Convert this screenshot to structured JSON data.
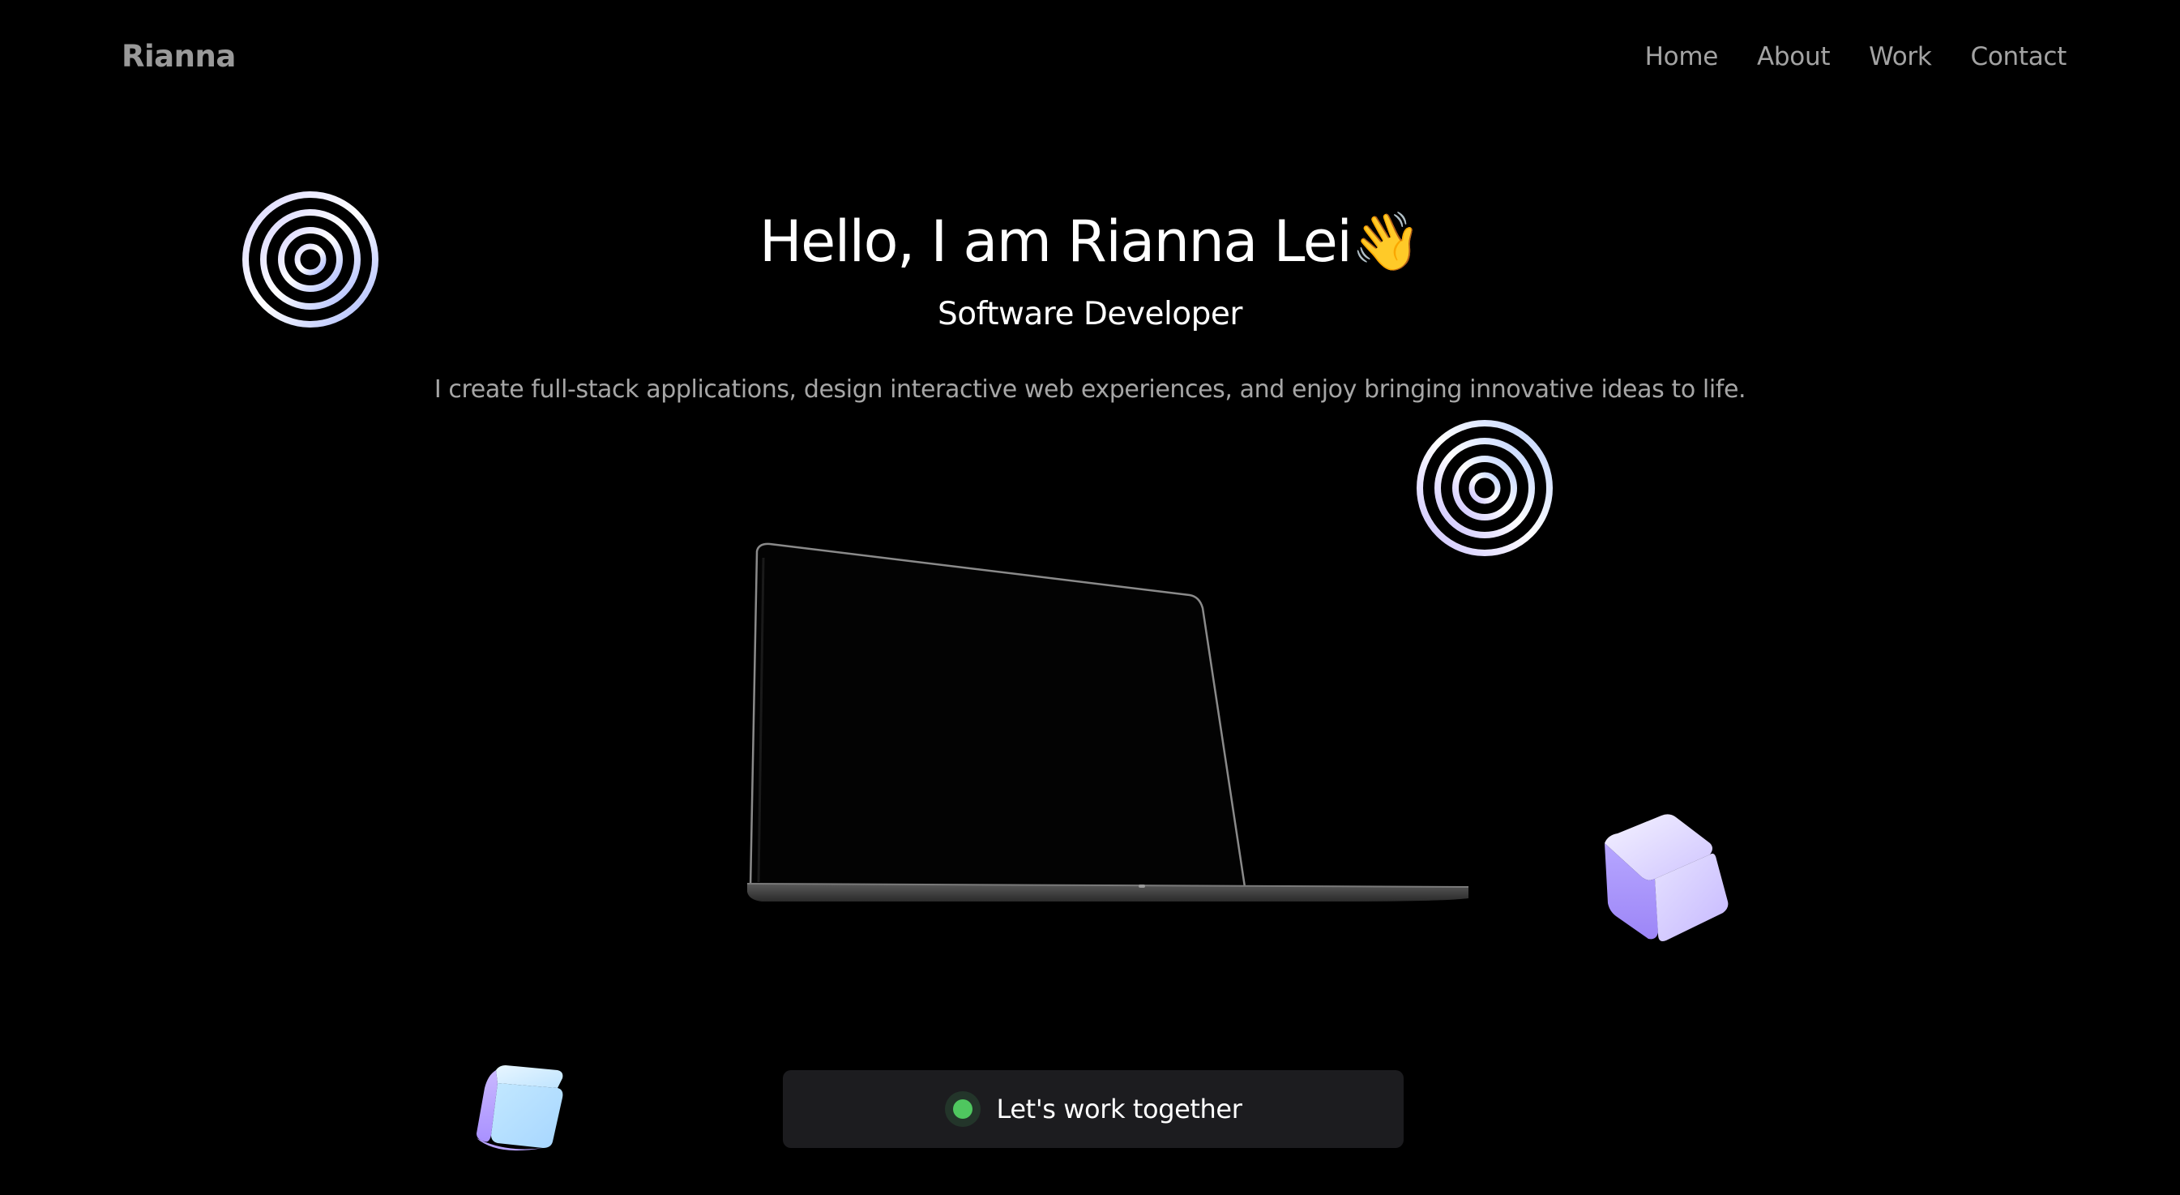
{
  "header": {
    "logo": "Rianna",
    "nav": [
      {
        "label": "Home"
      },
      {
        "label": "About"
      },
      {
        "label": "Work"
      },
      {
        "label": "Contact"
      }
    ]
  },
  "hero": {
    "title": "Hello, I am Rianna Lei👋",
    "subtitle": "Software Developer",
    "description": "I create full-stack applications, design interactive web experiences, and enjoy bringing innovative ideas to life."
  },
  "cta": {
    "label": "Let's work together",
    "status_color": "#4fc65f"
  },
  "decorations": {
    "rings_icon": "concentric-rings-icon",
    "cube_icon": "cube-icon",
    "laptop_icon": "laptop-icon",
    "accent_colors": [
      "#c9c6ff",
      "#bdeaff",
      "#b9a8ff"
    ]
  }
}
